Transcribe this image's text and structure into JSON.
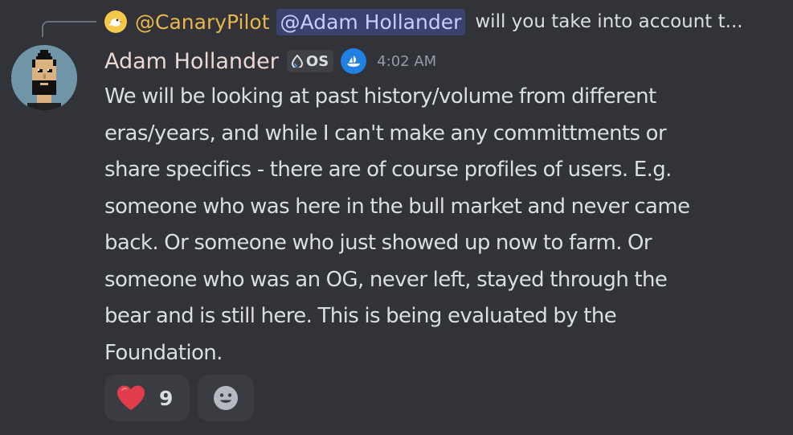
{
  "reply": {
    "author": "@CanaryPilot",
    "mention": "@Adam Hollander",
    "preview": "will you take into account t..."
  },
  "message": {
    "author": "Adam Hollander",
    "role_tag": "OS",
    "timestamp": "4:02 AM",
    "lines": [
      "We will be looking at past history/volume from different",
      "eras/years, and while I can't make any committments or",
      "share specifics - there are of course profiles of users. E.g.",
      "someone who was here in the bull market and never came",
      "back. Or someone who just showed up now to farm. Or",
      "someone who was an OG, never left, stayed through the",
      "bear and is still here. This is being evaluated by the",
      "Foundation."
    ]
  },
  "reactions": [
    {
      "icon": "heart-icon",
      "count": "9"
    },
    {
      "icon": "add-reaction-icon"
    }
  ],
  "colors": {
    "background": "#313338",
    "reply_author": "#e8b64a",
    "mention_bg": "#3c4270",
    "mention_text": "#c9cdfb",
    "author": "#ecd8d3",
    "heart": "#e23d4b",
    "opensea": "#2081e2"
  }
}
